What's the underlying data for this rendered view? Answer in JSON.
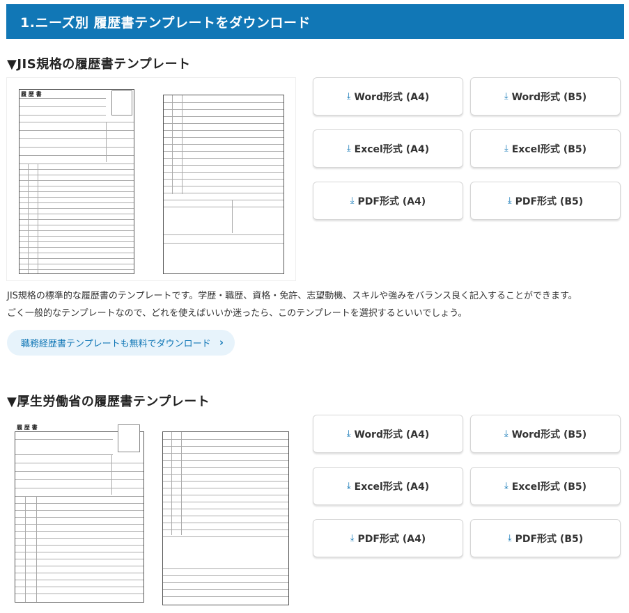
{
  "header": {
    "title": "1.ニーズ別 履歴書テンプレートをダウンロード"
  },
  "sections": [
    {
      "title": "▼JIS規格の履歴書テンプレート",
      "preview": {
        "sheet_title": "履 歴 書"
      },
      "buttons": [
        "Word形式 (A4)",
        "Word形式 (B5)",
        "Excel形式 (A4)",
        "Excel形式 (B5)",
        "PDF形式 (A4)",
        "PDF形式 (B5)"
      ],
      "description": [
        "JIS規格の標準的な履歴書のテンプレートです。学歴・職歴、資格・免許、志望動機、スキルや強みをバランス良く記入することができます。",
        "ごく一般的なテンプレートなので、どれを使えばいいか迷ったら、このテンプレートを選択するといいでしょう。"
      ],
      "link": "職務経歴書テンプレートも無料でダウンロード"
    },
    {
      "title": "▼厚生労働省の履歴書テンプレート",
      "preview": {
        "sheet_title": "履 歴 書"
      },
      "buttons": [
        "Word形式 (A4)",
        "Word形式 (B5)",
        "Excel形式 (A4)",
        "Excel形式 (B5)",
        "PDF形式 (A4)",
        "PDF形式 (B5)"
      ]
    }
  ],
  "icons": {
    "download": "download-icon",
    "chevron": "chevron-right-icon"
  },
  "colors": {
    "accent": "#1177b6",
    "link_bg": "#e7f3fb"
  }
}
